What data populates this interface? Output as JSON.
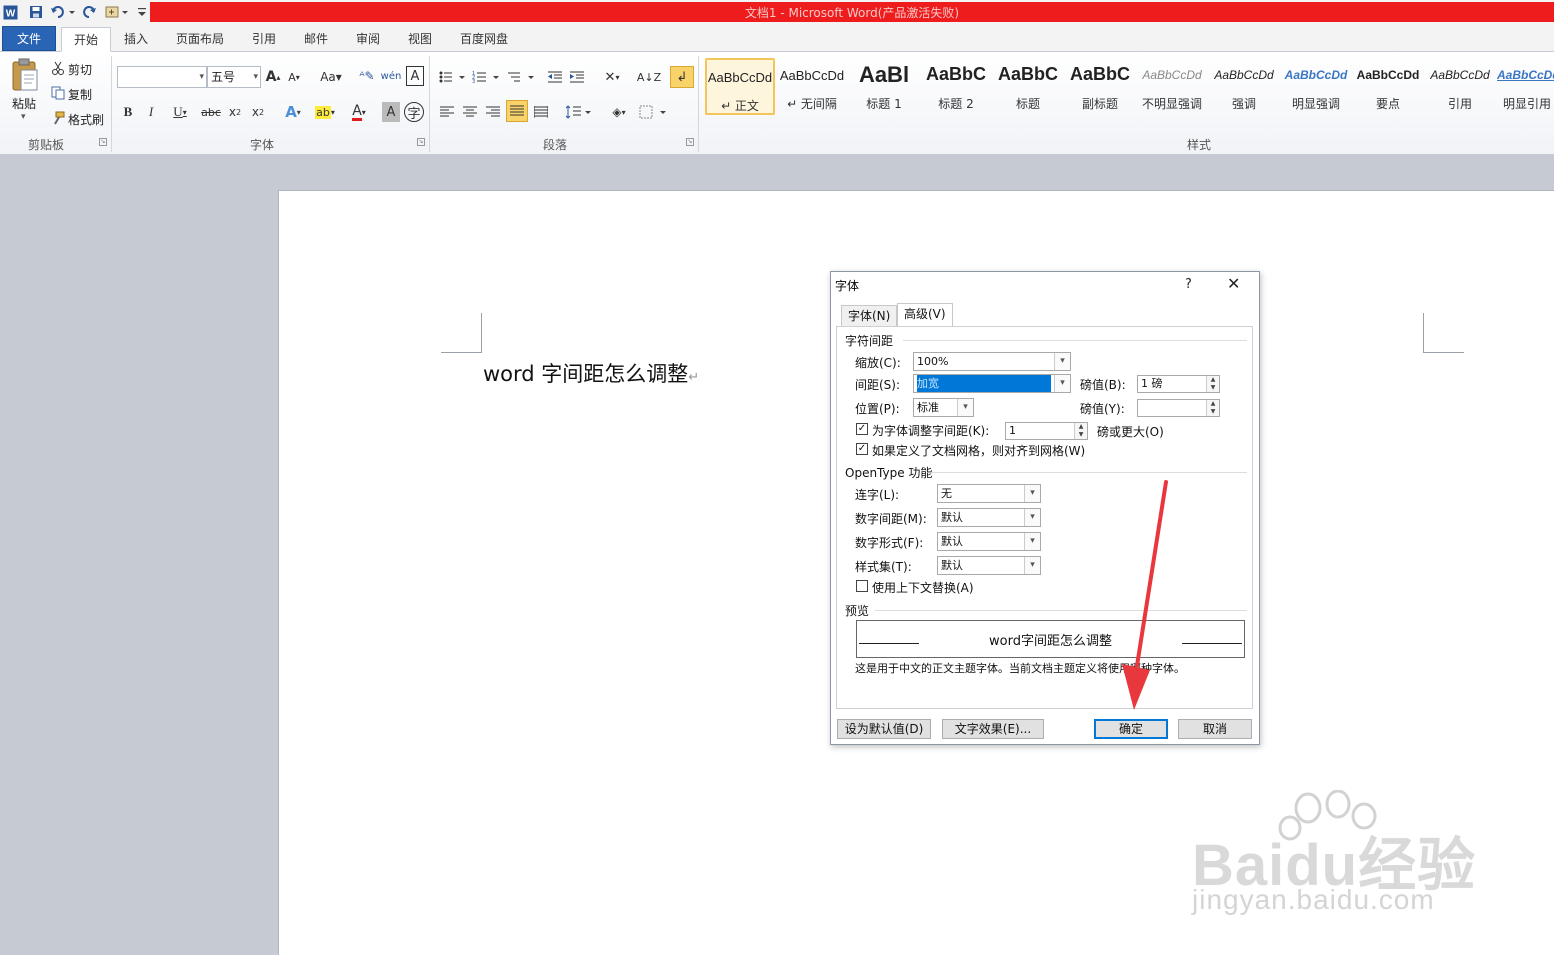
{
  "window": {
    "title": "文档1 - Microsoft Word(产品激活失败)"
  },
  "tabs": [
    {
      "label": "文件"
    },
    {
      "label": "开始"
    },
    {
      "label": "插入"
    },
    {
      "label": "页面布局"
    },
    {
      "label": "引用"
    },
    {
      "label": "邮件"
    },
    {
      "label": "审阅"
    },
    {
      "label": "视图"
    },
    {
      "label": "百度网盘"
    }
  ],
  "clipboard": {
    "paste": "粘贴",
    "cut": "剪切",
    "copy": "复制",
    "format_painter": "格式刷",
    "group": "剪贴板"
  },
  "font": {
    "font_name": "",
    "font_size": "五号",
    "group": "字体"
  },
  "paragraph": {
    "group": "段落"
  },
  "styles": {
    "group": "样式",
    "items": [
      {
        "sample": "AaBbCcDd",
        "name": "↵ 正文"
      },
      {
        "sample": "AaBbCcDd",
        "name": "↵ 无间隔"
      },
      {
        "sample": "AaBl",
        "name": "标题 1"
      },
      {
        "sample": "AaBbC",
        "name": "标题 2"
      },
      {
        "sample": "AaBbC",
        "name": "标题"
      },
      {
        "sample": "AaBbC",
        "name": "副标题"
      },
      {
        "sample": "AaBbCcDd",
        "name": "不明显强调"
      },
      {
        "sample": "AaBbCcDd",
        "name": "强调"
      },
      {
        "sample": "AaBbCcDd",
        "name": "明显强调"
      },
      {
        "sample": "AaBbCcDd",
        "name": "要点"
      },
      {
        "sample": "AaBbCcDd",
        "name": "引用"
      },
      {
        "sample": "AaBbCcDd",
        "name": "明显引用"
      }
    ]
  },
  "document": {
    "text": "word 字间距怎么调整",
    "mark": "↵"
  },
  "dialog": {
    "title": "字体",
    "help": "?",
    "close": "✕",
    "tabs": [
      {
        "label": "字体(N)"
      },
      {
        "label": "高级(V)"
      }
    ],
    "spacing_section": "字符间距",
    "scale_label": "缩放(C):",
    "scale_value": "100%",
    "spacing_label": "间距(S):",
    "spacing_value": "加宽",
    "spacing_by_label": "磅值(B):",
    "spacing_by_value": "1 磅",
    "position_label": "位置(P):",
    "position_value": "标准",
    "position_by_label": "磅值(Y):",
    "position_by_value": "",
    "kerning_label": "为字体调整字间距(K):",
    "kerning_value": "1",
    "kerning_suffix": "磅或更大(O)",
    "kerning_checked": true,
    "grid_label": "如果定义了文档网格，则对齐到网格(W)",
    "grid_checked": true,
    "opentype_section": "OpenType 功能",
    "ligatures_label": "连字(L):",
    "ligatures_value": "无",
    "number_spacing_label": "数字间距(M):",
    "number_spacing_value": "默认",
    "number_forms_label": "数字形式(F):",
    "number_forms_value": "默认",
    "stylistic_sets_label": "样式集(T):",
    "stylistic_sets_value": "默认",
    "contextual_label": "使用上下文替换(A)",
    "contextual_checked": false,
    "preview_section": "预览",
    "preview_text": "word字间距怎么调整",
    "preview_note": "这是用于中文的正文主题字体。当前文档主题定义将使用哪种字体。",
    "default_button": "设为默认值(D)",
    "effects_button": "文字效果(E)...",
    "ok_button": "确定",
    "cancel_button": "取消"
  },
  "watermark": {
    "name": "Baidu经验",
    "url": "jingyan.baidu.com"
  },
  "colors": {
    "title_bar": "#ee1c1c",
    "file_tab": "#2a65b5",
    "selection": "#0078d7",
    "arrow": "#e8383d"
  }
}
